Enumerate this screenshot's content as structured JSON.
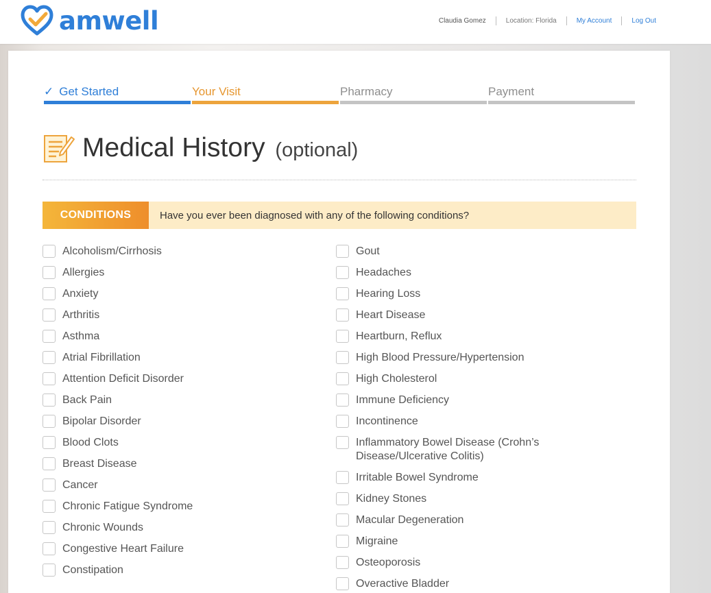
{
  "brand": {
    "name": "amwell",
    "color": "#2f7fd8",
    "accent": "#eda43c"
  },
  "topnav": {
    "user": "Claudia Gomez",
    "location": "Location: Florida",
    "my_account": "My Account",
    "logout": "Log Out"
  },
  "steps": [
    {
      "label": "Get Started",
      "state": "done"
    },
    {
      "label": "Your Visit",
      "state": "current"
    },
    {
      "label": "Pharmacy",
      "state": "todo"
    },
    {
      "label": "Payment",
      "state": "todo"
    }
  ],
  "page": {
    "title": "Medical History",
    "optional": "(optional)"
  },
  "conditions": {
    "badge": "CONDITIONS",
    "question": "Have you ever been diagnosed with any of the following conditions?",
    "left": [
      "Alcoholism/Cirrhosis",
      "Allergies",
      "Anxiety",
      "Arthritis",
      "Asthma",
      "Atrial Fibrillation",
      "Attention Deficit Disorder",
      "Back Pain",
      "Bipolar Disorder",
      "Blood Clots",
      "Breast Disease",
      "Cancer",
      "Chronic Fatigue Syndrome",
      "Chronic Wounds",
      "Congestive Heart Failure",
      "Constipation"
    ],
    "right": [
      "Gout",
      "Headaches",
      "Hearing Loss",
      "Heart Disease",
      "Heartburn, Reflux",
      "High Blood Pressure/Hypertension",
      "High Cholesterol",
      "Immune Deficiency",
      "Incontinence",
      "Inflammatory Bowel Disease (Crohn’s Disease/Ulcerative Colitis)",
      "Irritable Bowel Syndrome",
      "Kidney Stones",
      "Macular Degeneration",
      "Migraine",
      "Osteoporosis",
      "Overactive Bladder"
    ]
  }
}
